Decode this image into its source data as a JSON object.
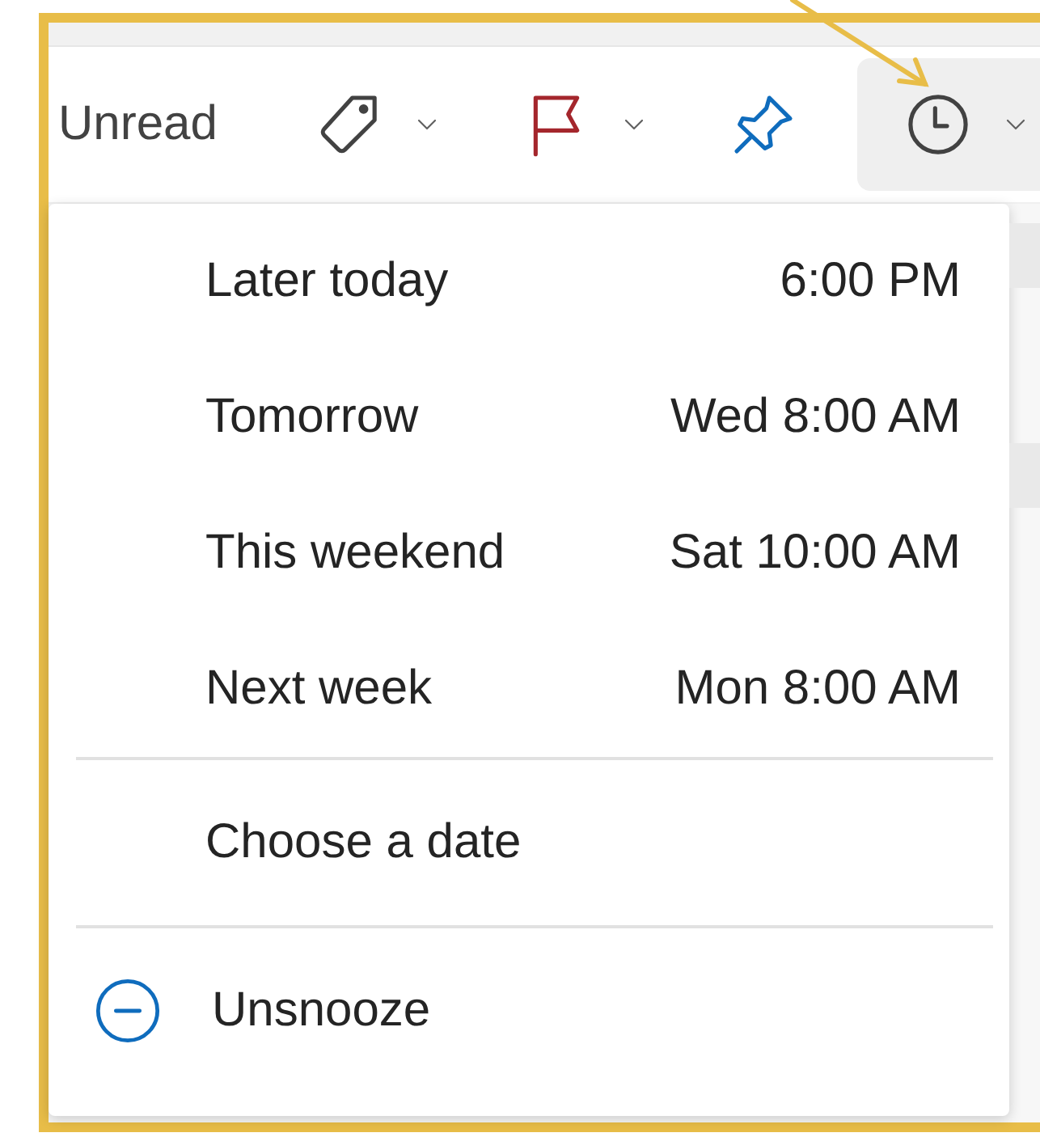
{
  "toolbar": {
    "label": "Unread",
    "buttons": [
      {
        "kind": "tag",
        "selected": false,
        "has_menu": true
      },
      {
        "kind": "flag",
        "selected": false,
        "has_menu": true
      },
      {
        "kind": "pin",
        "selected": false,
        "has_menu": false
      },
      {
        "kind": "snooze",
        "selected": true,
        "has_menu": true
      }
    ]
  },
  "snooze_menu": {
    "options": [
      {
        "label": "Later today",
        "time": "6:00 PM"
      },
      {
        "label": "Tomorrow",
        "time": "Wed 8:00 AM"
      },
      {
        "label": "This weekend",
        "time": "Sat 10:00 AM"
      },
      {
        "label": "Next week",
        "time": "Mon 8:00 AM"
      }
    ],
    "choose_date": "Choose a date",
    "unsnooze": "Unsnooze"
  }
}
